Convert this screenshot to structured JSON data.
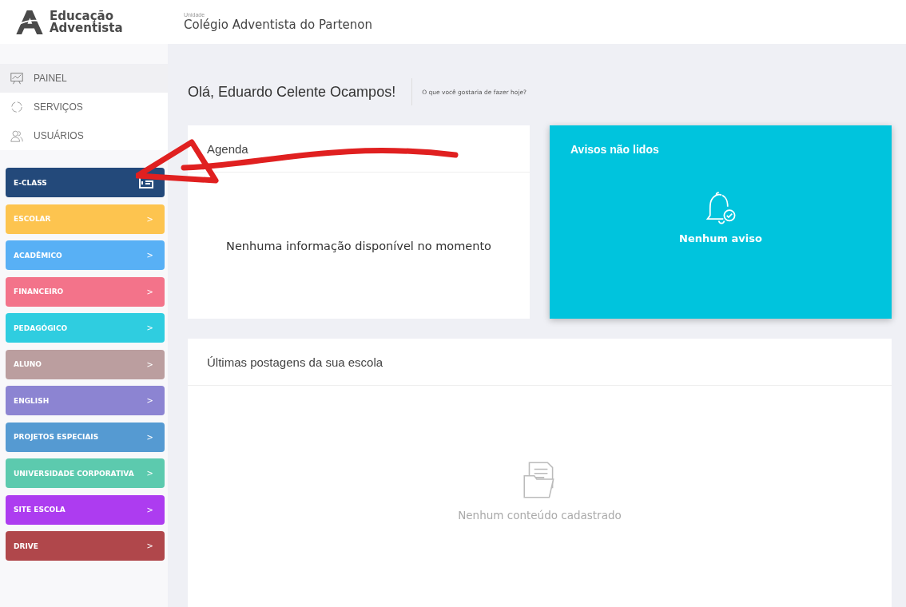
{
  "header": {
    "logo_line1": "Educação",
    "logo_line2": "Adventista",
    "unit_label": "Unidade",
    "unit_name": "Colégio Adventista do Partenon"
  },
  "nav": [
    {
      "label": "PAINEL",
      "selected": true,
      "kind": "chart"
    },
    {
      "label": "SERVIÇOS",
      "selected": false,
      "kind": "services"
    },
    {
      "label": "USUÁRIOS",
      "selected": false,
      "kind": "users"
    }
  ],
  "modules": [
    {
      "label": "E-CLASS",
      "color": "#23497a",
      "kind": "external"
    },
    {
      "label": "ESCOLAR",
      "color": "#fdc44f",
      "kind": "chevron"
    },
    {
      "label": "ACADÊMICO",
      "color": "#58b0f5",
      "kind": "chevron"
    },
    {
      "label": "FINANCEIRO",
      "color": "#f3738a",
      "kind": "chevron"
    },
    {
      "label": "PEDAGÓGICO",
      "color": "#2fcde0",
      "kind": "chevron"
    },
    {
      "label": "ALUNO",
      "color": "#bb9e9f",
      "kind": "chevron"
    },
    {
      "label": "ENGLISH",
      "color": "#8c84d2",
      "kind": "chevron"
    },
    {
      "label": "PROJETOS ESPECIAIS",
      "color": "#559ad2",
      "kind": "chevron"
    },
    {
      "label": "UNIVERSIDADE CORPORATIVA",
      "color": "#5ccaae",
      "kind": "chevron"
    },
    {
      "label": "SITE ESCOLA",
      "color": "#ad3cf0",
      "kind": "chevron"
    },
    {
      "label": "DRIVE",
      "color": "#b0474b",
      "kind": "chevron"
    }
  ],
  "chevron": ">",
  "greeting": "Olá, Eduardo Celente Ocampos!",
  "subtitle": "O que você gostaria de fazer hoje?",
  "agenda": {
    "title": "Agenda",
    "empty": "Nenhuma informação disponível no momento"
  },
  "notices": {
    "title": "Avisos não lidos",
    "empty": "Nenhum aviso"
  },
  "posts": {
    "title": "Últimas postagens da sua escola",
    "empty": "Nenhum conteúdo cadastrado"
  }
}
